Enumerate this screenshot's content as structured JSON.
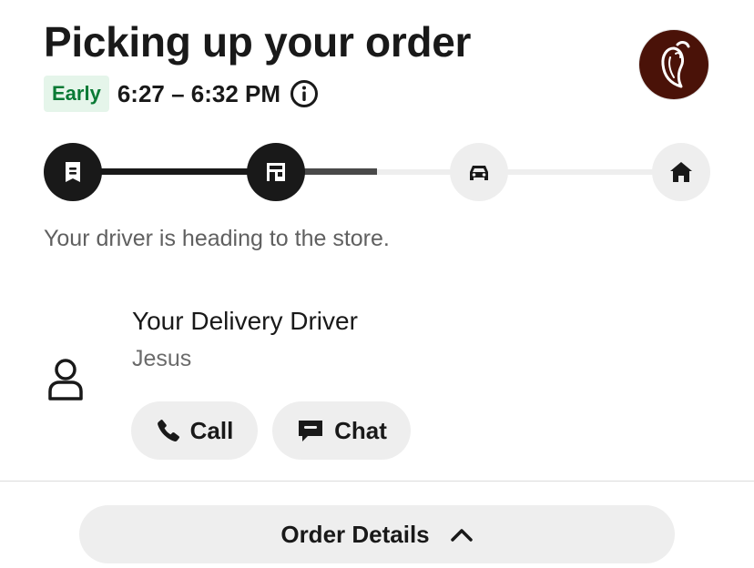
{
  "header": {
    "title": "Picking up your order",
    "eta_badge": "Early",
    "eta_window": "6:27 – 6:32 PM",
    "info_icon": "info-circle-icon",
    "merchant_logo_icon": "chili-pepper-logo-icon"
  },
  "progress": {
    "steps": [
      {
        "name": "order-placed",
        "icon": "receipt-icon",
        "state": "complete"
      },
      {
        "name": "store",
        "icon": "store-icon",
        "state": "current"
      },
      {
        "name": "on-the-way",
        "icon": "car-icon",
        "state": "upcoming"
      },
      {
        "name": "delivered",
        "icon": "home-icon",
        "state": "upcoming"
      }
    ],
    "status_text": "Your driver is heading to the store."
  },
  "driver": {
    "title": "Your Delivery Driver",
    "name": "Jesus",
    "icon": "person-icon",
    "call_label": "Call",
    "chat_label": "Chat"
  },
  "footer": {
    "order_details_label": "Order Details",
    "chevron_icon": "chevron-up-icon"
  },
  "colors": {
    "text_primary": "#191919",
    "badge_bg": "#e5f5ea",
    "badge_text": "#0a7a35",
    "button_bg": "#eeeeee",
    "logo_bg": "#4a1208"
  }
}
